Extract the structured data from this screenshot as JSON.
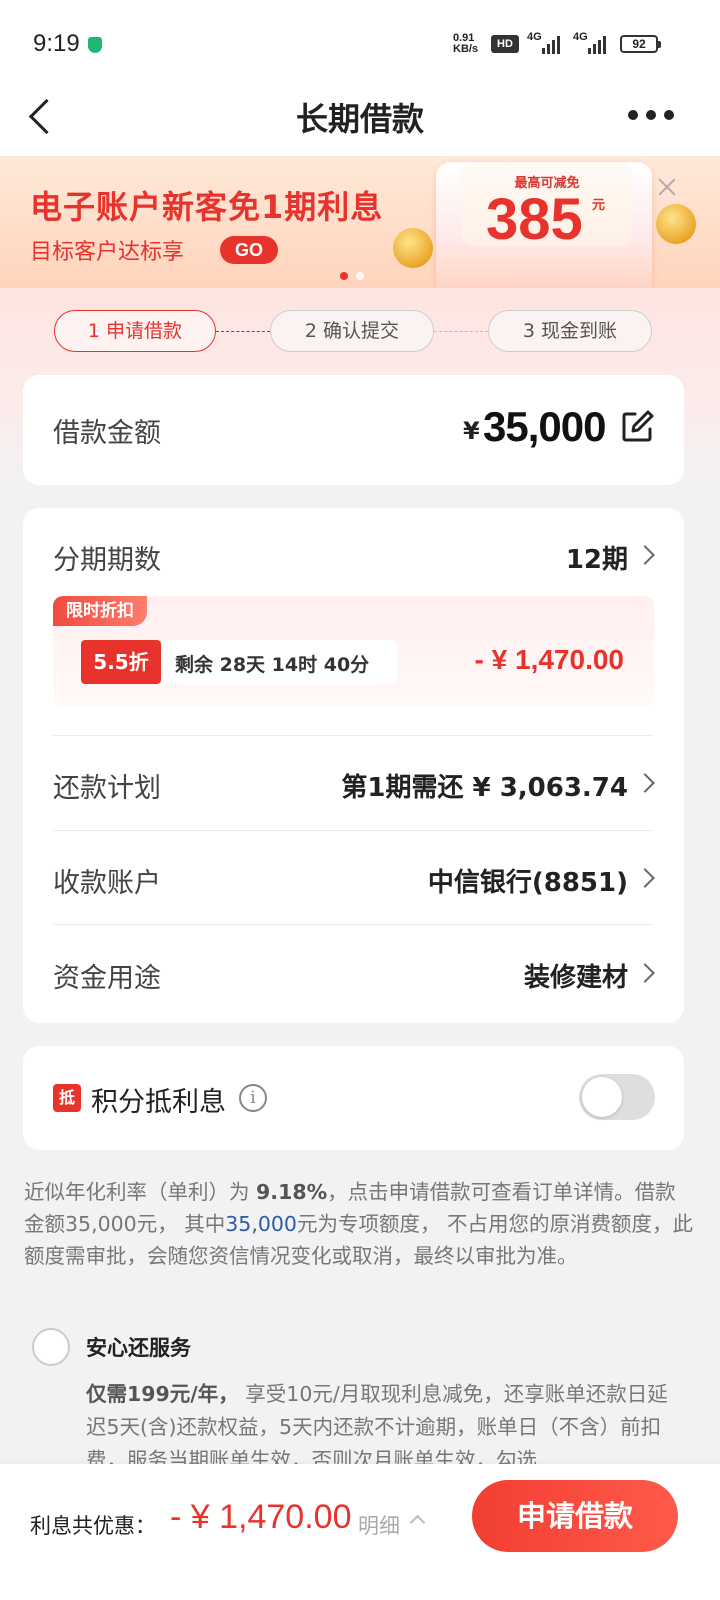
{
  "status_bar": {
    "time": "9:19",
    "net_speed_value": "0.91",
    "net_speed_unit": "KB/s",
    "hd_label": "HD",
    "signal_1": "4G",
    "signal_2": "4G",
    "battery": "92"
  },
  "nav": {
    "title": "长期借款",
    "back_icon": "chevron-left-icon",
    "more_icon": "more-dots-icon"
  },
  "banner": {
    "title": "电子账户新客免1期利息",
    "subtitle": "目标客户达标享",
    "go_label": "GO",
    "max_label": "最高可减免",
    "amount": "385",
    "unit": "元"
  },
  "steps": [
    {
      "label": "1 申请借款",
      "active": true
    },
    {
      "label": "2 确认提交",
      "active": false
    },
    {
      "label": "3 现金到账",
      "active": false
    }
  ],
  "amount_card": {
    "label": "借款金额",
    "currency": "¥",
    "value": "35,000"
  },
  "installments": {
    "label": "分期期数",
    "value": "12期"
  },
  "promo": {
    "tag": "限时折扣",
    "discount": "5.5折",
    "countdown": "剩余 28天 14时 40分",
    "amount": "- ¥ 1,470.00"
  },
  "repay_plan": {
    "label": "还款计划",
    "value": "第1期需还 ¥ 3,063.74"
  },
  "account": {
    "label": "收款账户",
    "value": "中信银行(8851)"
  },
  "usage": {
    "label": "资金用途",
    "value": "装修建材"
  },
  "points": {
    "badge": "抵",
    "label": "积分抵利息",
    "toggle_on": false
  },
  "notice": {
    "p1_prefix": "近似年化利率（单利）为 ",
    "rate": "9.18%",
    "p1_suffix": "，点击申请借款可查看订单详情。借款金额35,000元， 其中",
    "special_amount": "35,000",
    "p2": "元为专项额度， 不占用您的原消费额度，此额度需审批，会随您资信情况变化或取消，最终以审批为准。"
  },
  "service": {
    "title": "安心还服务",
    "price": "仅需199元/年，",
    "desc": " 享受10元/月取现利息减免，还享账单还款日延迟5天(含)还款权益，5天内还款不计逾期，账单日（不含）前扣费，服务当期账单生效，否则次月账单生效，勾选"
  },
  "bottom": {
    "label": "利息共优惠：",
    "amount": "- ¥ 1,470.00",
    "detail": "明细",
    "apply": "申请借款"
  },
  "colors": {
    "accent": "#e8332d",
    "link_blue": "#2e5ba8",
    "background": "#f2f2f4"
  }
}
